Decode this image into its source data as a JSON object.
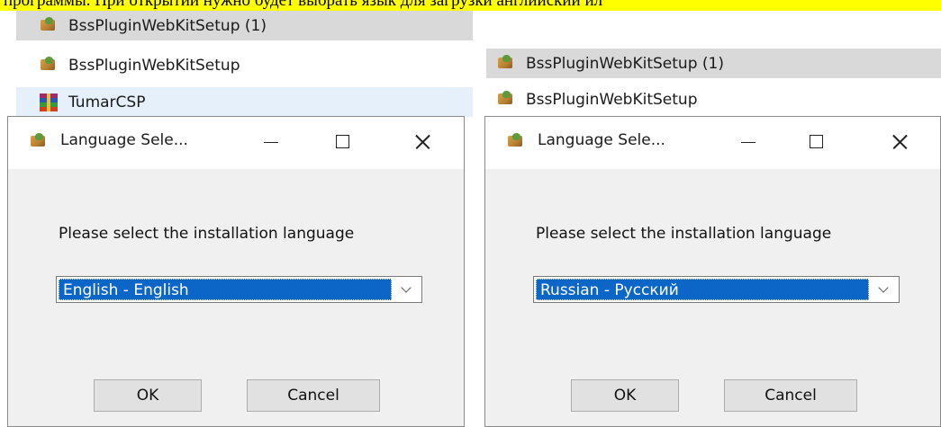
{
  "banner": {
    "text": "программы. При открытии нужно будет выбрать язык для загрузки английский ил"
  },
  "left_files": [
    {
      "name": "BssPluginWebKitSetup (1)",
      "icon": "setup-icon",
      "selected": true
    },
    {
      "name": "BssPluginWebKitSetup",
      "icon": "setup-icon",
      "selected": false
    },
    {
      "name": "TumarCSP",
      "icon": "winrar-icon",
      "selected": false
    }
  ],
  "right_files": [
    {
      "name": "BssPluginWebKitSetup (1)",
      "icon": "setup-icon",
      "selected": true
    },
    {
      "name": "BssPluginWebKitSetup",
      "icon": "setup-icon",
      "selected": false
    }
  ],
  "dialog_left": {
    "title": "Language Sele...",
    "prompt": "Please select the installation language",
    "selected_language": "English - English",
    "ok_label": "OK",
    "cancel_label": "Cancel"
  },
  "dialog_right": {
    "title": "Language Sele...",
    "prompt": "Please select the installation language",
    "selected_language": "Russian - Русский",
    "ok_label": "OK",
    "cancel_label": "Cancel"
  },
  "colors": {
    "highlight": "#0c66c8",
    "banner": "#ffff00",
    "selected_row": "#d9d9d9",
    "hover_row": "#e5f0fb"
  }
}
